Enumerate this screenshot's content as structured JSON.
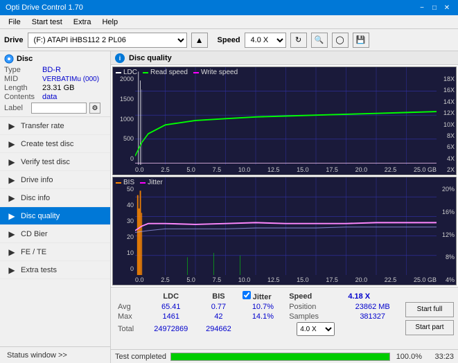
{
  "app": {
    "title": "Opti Drive Control 1.70",
    "titlebar_controls": [
      "minimize",
      "maximize",
      "close"
    ]
  },
  "menubar": {
    "items": [
      "File",
      "Start test",
      "Extra",
      "Help"
    ]
  },
  "drivebar": {
    "drive_label": "Drive",
    "drive_value": "(F:) ATAPI iHBS112  2 PL06",
    "speed_label": "Speed",
    "speed_value": "4.0 X"
  },
  "disc": {
    "type_label": "Type",
    "type_value": "BD-R",
    "mid_label": "MID",
    "mid_value": "VERBATIMu (000)",
    "length_label": "Length",
    "length_value": "23.31 GB",
    "contents_label": "Contents",
    "contents_value": "data",
    "label_label": "Label",
    "label_value": ""
  },
  "nav": {
    "items": [
      {
        "id": "transfer-rate",
        "label": "Transfer rate",
        "active": false
      },
      {
        "id": "create-test-disc",
        "label": "Create test disc",
        "active": false
      },
      {
        "id": "verify-test-disc",
        "label": "Verify test disc",
        "active": false
      },
      {
        "id": "drive-info",
        "label": "Drive info",
        "active": false
      },
      {
        "id": "disc-info",
        "label": "Disc info",
        "active": false
      },
      {
        "id": "disc-quality",
        "label": "Disc quality",
        "active": true
      },
      {
        "id": "cd-bier",
        "label": "CD Bier",
        "active": false
      },
      {
        "id": "fe-te",
        "label": "FE / TE",
        "active": false
      },
      {
        "id": "extra-tests",
        "label": "Extra tests",
        "active": false
      }
    ],
    "status_window": "Status window >>"
  },
  "disc_quality": {
    "title": "Disc quality",
    "chart1": {
      "legend": [
        {
          "label": "LDC",
          "color": "#ffffff"
        },
        {
          "label": "Read speed",
          "color": "#00ff00"
        },
        {
          "label": "Write speed",
          "color": "#ff00ff"
        }
      ],
      "y_left": [
        "2000",
        "1500",
        "1000",
        "500",
        "0"
      ],
      "y_right": [
        "18X",
        "16X",
        "14X",
        "12X",
        "10X",
        "8X",
        "6X",
        "4X",
        "2X"
      ],
      "x_labels": [
        "0.0",
        "2.5",
        "5.0",
        "7.5",
        "10.0",
        "12.5",
        "15.0",
        "17.5",
        "20.0",
        "22.5",
        "25.0 GB"
      ]
    },
    "chart2": {
      "legend": [
        {
          "label": "BIS",
          "color": "#ff8800"
        },
        {
          "label": "Jitter",
          "color": "#ff00ff"
        }
      ],
      "y_left": [
        "50",
        "40",
        "30",
        "20",
        "10",
        "0"
      ],
      "y_right": [
        "20%",
        "16%",
        "12%",
        "8%",
        "4%"
      ],
      "x_labels": [
        "0.0",
        "2.5",
        "5.0",
        "7.5",
        "10.0",
        "12.5",
        "15.0",
        "17.5",
        "20.0",
        "22.5",
        "25.0 GB"
      ]
    }
  },
  "stats": {
    "headers": [
      "LDC",
      "BIS",
      "",
      "Jitter",
      "Speed"
    ],
    "avg_label": "Avg",
    "avg_ldc": "65.41",
    "avg_bis": "0.77",
    "avg_jitter": "10.7%",
    "max_label": "Max",
    "max_ldc": "1461",
    "max_bis": "42",
    "max_jitter": "14.1%",
    "total_label": "Total",
    "total_ldc": "24972869",
    "total_bis": "294662",
    "speed_label": "Speed",
    "speed_value": "4.18 X",
    "speed_select": "4.0 X",
    "position_label": "Position",
    "position_value": "23862 MB",
    "samples_label": "Samples",
    "samples_value": "381327",
    "start_full_label": "Start full",
    "start_part_label": "Start part"
  },
  "progress": {
    "label": "Test completed",
    "percent": 100,
    "percent_text": "100.0%",
    "time": "33:23"
  }
}
